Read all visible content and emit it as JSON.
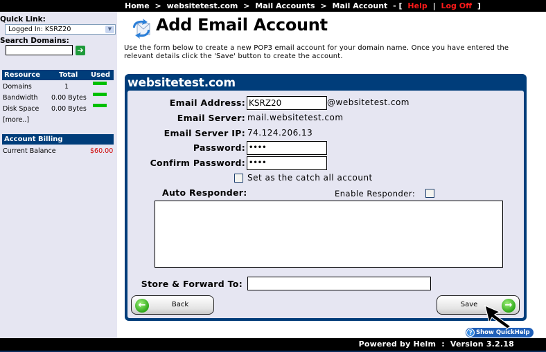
{
  "topbar": {
    "breadcrumb": [
      "Home",
      "websitetest.com",
      "Mail Accounts",
      "Mail Account"
    ],
    "separator": ">",
    "suffix_open": "- [",
    "help_label": "Help",
    "pipe": "|",
    "logoff_label": "Log Off",
    "suffix_close": "]"
  },
  "sidebar": {
    "quick_link_label": "Quick Link:",
    "quick_link_selected": "Logged In: KSRZ20",
    "search_label": "Search Domains:",
    "search_value": "",
    "search_go_icon": "arrow-right-icon",
    "resources": {
      "headers": [
        "Resource",
        "Total",
        "Used"
      ],
      "rows": [
        {
          "name": "Domains",
          "total": "1"
        },
        {
          "name": "Bandwidth",
          "total": "0.00 Bytes"
        },
        {
          "name": "Disk Space",
          "total": "0.00 Bytes"
        }
      ],
      "more_link": "[more..]",
      "used_color": "#00c000"
    },
    "billing": {
      "header": "Account Billing",
      "balance_label": "Current Balance",
      "balance_value": "$60.00"
    }
  },
  "main": {
    "title_icon": "email-sync-icon",
    "title": "Add Email Account",
    "intro": "Use the form below to create a new POP3 email account for your domain name. Once you have entered the relevant details click the 'Save' button to create the account.",
    "panel_title": "websitetest.com",
    "form": {
      "email_address_label": "Email Address:",
      "email_address_value": "KSRZ20",
      "email_domain_suffix": "@websitetest.com",
      "email_server_label": "Email Server:",
      "email_server_value": "mail.websitetest.com",
      "email_server_ip_label": "Email Server IP:",
      "email_server_ip_value": "74.124.206.13",
      "password_label": "Password:",
      "password_value": "••••",
      "confirm_password_label": "Confirm Password:",
      "confirm_password_value": "••••",
      "catch_all_label": "Set as the catch all account",
      "catch_all_checked": false,
      "auto_responder_label": "Auto Responder:",
      "enable_responder_label": "Enable Responder:",
      "enable_responder_checked": false,
      "auto_responder_text": "",
      "store_forward_label": "Store & Forward To:",
      "store_forward_value": ""
    },
    "back_label": "Back",
    "save_label": "Save",
    "quickhelp_label": "Show QuickHelp"
  },
  "footer": {
    "text": "Powered by Helm  :  Version 3.2.18"
  },
  "colors": {
    "navy": "#003d7a",
    "panel_bg": "#e6e6f2",
    "link_red": "#ff1a1a",
    "balance_red": "#d00000"
  }
}
